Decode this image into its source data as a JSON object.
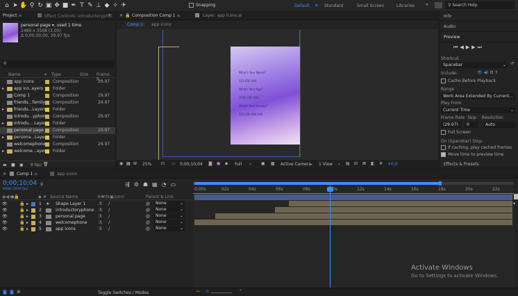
{
  "toolbar": {
    "snapping": "Snapping",
    "workspaces": [
      "Default",
      "Standard",
      "Small Screen",
      "Libraries"
    ],
    "search": "Search Help",
    "more": "»"
  },
  "project": {
    "tab": "Project",
    "effects_tab": "Effect Controls: introductoryphoi",
    "more": "»",
    "item_name": "personal page ▾, used 1 time",
    "item_size": "2480 x 3508 (1.00)",
    "item_dur": "Δ 0;00;30;00, 29.97 fps",
    "search_placeholder": "",
    "cols": [
      "Name",
      "Type",
      "Size",
      "Frame R..."
    ],
    "rows": [
      {
        "name": "app icons",
        "type": "Composition",
        "size": "",
        "fps": "29.97",
        "kind": "comp",
        "color": "#c6b25b",
        "expand": ""
      },
      {
        "name": "app ico..ayers",
        "type": "Folder",
        "size": "",
        "fps": "",
        "kind": "folder",
        "color": "#e2c93e",
        "expand": "▸"
      },
      {
        "name": "Comp 1",
        "type": "Composition",
        "size": "",
        "fps": "29.97",
        "kind": "comp",
        "color": "#c6b25b",
        "expand": ""
      },
      {
        "name": "friends...family",
        "type": "Composition",
        "size": "",
        "fps": "29.97",
        "kind": "comp",
        "color": "#c6b25b",
        "expand": ""
      },
      {
        "name": "friends...Layers",
        "type": "Folder",
        "size": "",
        "fps": "",
        "kind": "folder",
        "color": "#e2c93e",
        "expand": "▸"
      },
      {
        "name": "introdu...yphone",
        "type": "Composition",
        "size": "",
        "fps": "29.97",
        "kind": "comp",
        "color": "#c6b25b",
        "expand": ""
      },
      {
        "name": "Introdu... Layers",
        "type": "Folder",
        "size": "",
        "fps": "",
        "kind": "folder",
        "color": "#e2c93e",
        "expand": "▸"
      },
      {
        "name": "personal page",
        "type": "Composition",
        "size": "",
        "fps": "29.97",
        "kind": "comp",
        "color": "#c6b25b",
        "expand": ""
      },
      {
        "name": "persona...Layers",
        "type": "Folder",
        "size": "",
        "fps": "",
        "kind": "folder",
        "color": "#e2c93e",
        "expand": "▸"
      },
      {
        "name": "welcomephone",
        "type": "Composition",
        "size": "",
        "fps": "29.97",
        "kind": "comp",
        "color": "#c6b25b",
        "expand": ""
      },
      {
        "name": "welcome...ayers",
        "type": "Folder",
        "size": "",
        "fps": "",
        "kind": "folder",
        "color": "#e2c93e",
        "expand": "▸"
      }
    ],
    "bpc": "8 bpc"
  },
  "composition": {
    "tab": "Composition Comp 1",
    "layer_tab": "Layer: app icons.ai",
    "crumb1": "Comp 1",
    "crumb2": "app icons",
    "phone_lines": [
      "What's Your Name?",
      "123 456 000",
      "What's Your Age?",
      "(000) 000 000",
      "What's Your Gender?",
      "123 456 000 000"
    ],
    "zoom": "25%",
    "time": "0;00;10;04",
    "quality": "Full",
    "camera": "Active Camera",
    "view": "1 View",
    "exposure": "+0.0"
  },
  "right": {
    "info": "Info",
    "audio": "Audio",
    "preview": "Preview",
    "shortcut": "Shortcut",
    "shortcut_val": "Spacebar",
    "include": "Include:",
    "cache": "Cache Before Playback",
    "range": "Range",
    "range_val": "Work Area Extended By Current...",
    "play_from": "Play From",
    "play_from_val": "Current Time",
    "fr_label": "Frame Rate",
    "skip_label": "Skip",
    "res_label": "Resolution",
    "fr_val": "(29.97)",
    "skip_val": "0",
    "res_val": "Auto",
    "full": "Full Screen",
    "on_stop": "On (Spacebar) Stop:",
    "if_caching": "If caching, play cached frames",
    "move_time": "Move time to preview time",
    "effects": "Effects & Presets"
  },
  "timeline": {
    "tab1": "Comp 1",
    "tab2": "app icons",
    "time": "0;00;10;04",
    "sub": "00304 (29.97 fps)",
    "col_source": "Source Name",
    "col_parent": "Parent & Link",
    "ruler": [
      "0:00s",
      "02s",
      "04s",
      "06s",
      "08s",
      "10s",
      "12s",
      "14s",
      "16s",
      "18s",
      "20s",
      "22s"
    ],
    "layers": [
      {
        "num": "1",
        "name": "Shape Layer 1",
        "parent": "None",
        "star": true,
        "color": "#5b6ecc"
      },
      {
        "num": "2",
        "name": "introductoryphone",
        "parent": "None",
        "star": false,
        "color": "#c6b25b"
      },
      {
        "num": "3",
        "name": "personal page",
        "parent": "None",
        "star": false,
        "color": "#c6b25b"
      },
      {
        "num": "4",
        "name": "welcomephone",
        "parent": "None",
        "star": false,
        "color": "#c6b25b"
      },
      {
        "num": "5",
        "name": "app icons",
        "parent": "None",
        "star": false,
        "color": "#c6b25b"
      }
    ],
    "toggle": "Toggle Switches / Modes"
  },
  "watermark": {
    "title": "Activate Windows",
    "sub": "Go to Settings to activate Windows."
  }
}
